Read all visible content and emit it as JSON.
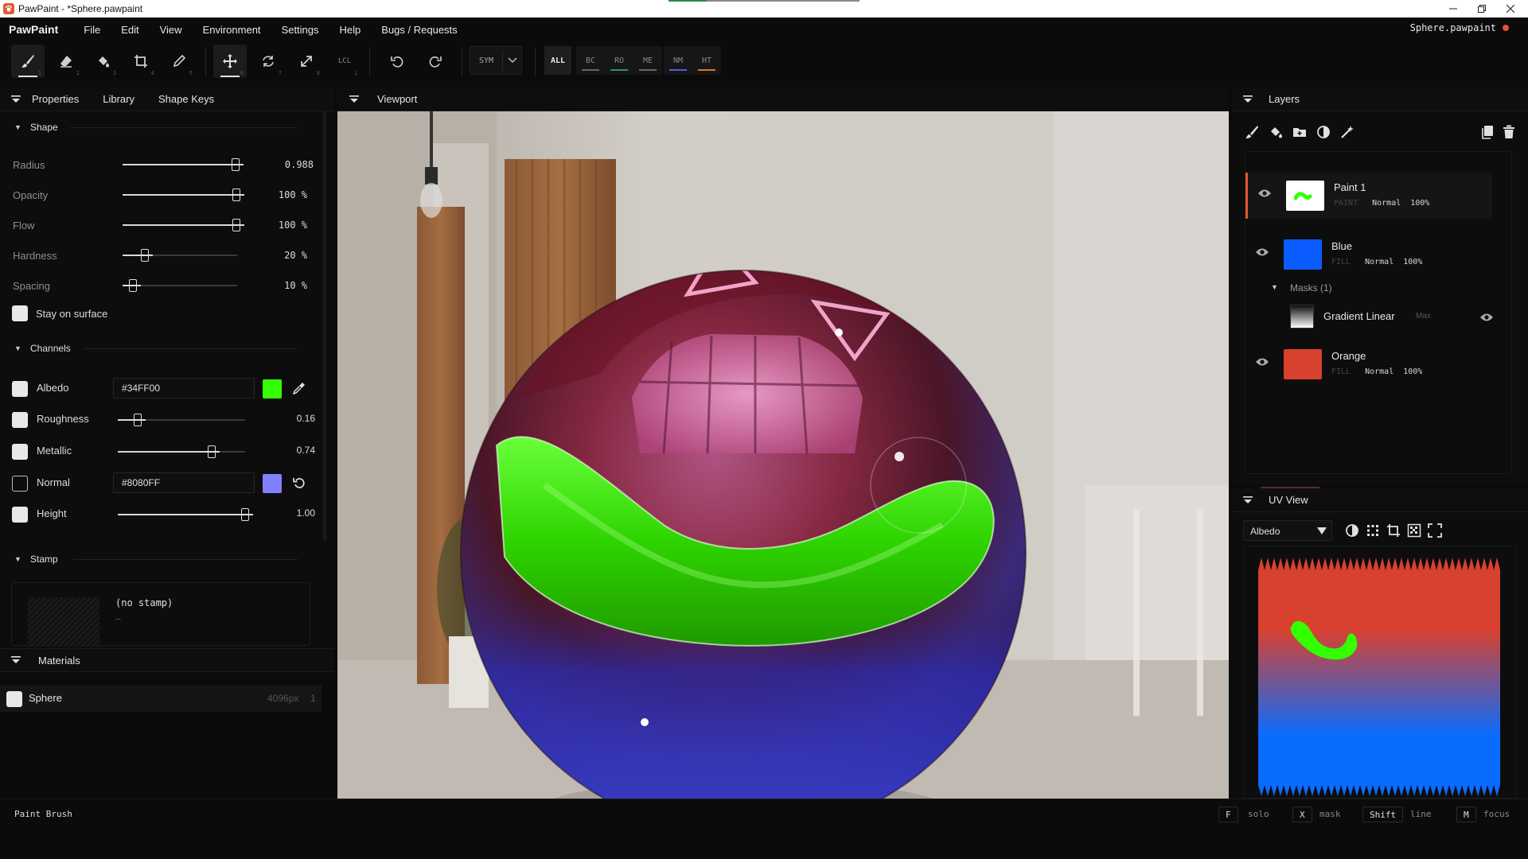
{
  "window": {
    "title": "PawPaint - *Sphere.pawpaint",
    "controls": [
      "minimize-icon",
      "restore-icon",
      "close-icon"
    ]
  },
  "menu": {
    "brand": "PawPaint",
    "items": [
      "File",
      "Edit",
      "View",
      "Environment",
      "Settings",
      "Help",
      "Bugs / Requests"
    ],
    "open_file": "Sphere.pawpaint",
    "unsaved_color": "#e8502e"
  },
  "toolbar": {
    "tools": [
      {
        "name": "brush-icon",
        "key": "1",
        "active": true
      },
      {
        "name": "eraser-icon",
        "key": "2"
      },
      {
        "name": "fill-bucket-icon",
        "key": "3"
      },
      {
        "name": "crop-icon",
        "key": "4"
      },
      {
        "name": "eyedropper-icon",
        "key": "5"
      },
      {
        "name": "move-icon",
        "key": "6",
        "active": true
      },
      {
        "name": "rotate-icon",
        "key": "7"
      },
      {
        "name": "scale-icon",
        "key": "8"
      },
      {
        "name": "local-icon",
        "key": "L"
      }
    ],
    "local_label": "LCL",
    "undo": "undo-icon",
    "redo": "redo-icon",
    "sym_label": "SYM",
    "channels": [
      {
        "label": "ALL",
        "color": ""
      },
      {
        "label": "BC",
        "color": "#666666"
      },
      {
        "label": "RO",
        "color": "#2a9a5a"
      },
      {
        "label": "ME",
        "color": "#666666"
      },
      {
        "label": "NM",
        "color": "#5a5adc"
      },
      {
        "label": "HT",
        "color": "#d07a2a"
      }
    ]
  },
  "left_panel": {
    "tabs": [
      "Properties",
      "Library",
      "Shape Keys"
    ],
    "shape": {
      "title": "Shape",
      "params": [
        {
          "label": "Radius",
          "value": "0.988",
          "level": 0.99
        },
        {
          "label": "Opacity",
          "value": "100 %",
          "level": 1.0
        },
        {
          "label": "Flow",
          "value": "100 %",
          "level": 1.0
        },
        {
          "label": "Hardness",
          "value": "20 %",
          "level": 0.2
        },
        {
          "label": "Spacing",
          "value": "10 %",
          "level": 0.1
        }
      ],
      "stay_on_surface": "Stay on surface"
    },
    "channels": {
      "title": "Channels",
      "albedo": {
        "label": "Albedo",
        "hex": "#34FF00",
        "color": "#34FF00"
      },
      "roughness": {
        "label": "Roughness",
        "value": "0.16",
        "level": 0.16
      },
      "metallic": {
        "label": "Metallic",
        "value": "0.74",
        "level": 0.74
      },
      "normal": {
        "label": "Normal",
        "hex": "#8080FF",
        "color": "#8080FF"
      },
      "height": {
        "label": "Height",
        "value": "1.00",
        "level": 1.0
      }
    },
    "stamp": {
      "title": "Stamp",
      "name": "(no stamp)",
      "sub": "–"
    }
  },
  "materials": {
    "title": "Materials",
    "items": [
      {
        "name": "Sphere",
        "size": "4096px",
        "count": "1"
      }
    ]
  },
  "viewport": {
    "title": "Viewport"
  },
  "layers": {
    "title": "Layers",
    "items": [
      {
        "name": "Paint 1",
        "type": "PAINT",
        "blend": "Normal",
        "opacity": "100%",
        "selected": true
      },
      {
        "name": "Blue",
        "type": "FILL",
        "blend": "Normal",
        "opacity": "100%",
        "color": "#0a5cff"
      },
      {
        "name": "Orange",
        "type": "FILL",
        "blend": "Normal",
        "opacity": "100%",
        "color": "#d8412e"
      }
    ],
    "masks_label": "Masks (1)",
    "mask": {
      "name": "Gradient Linear",
      "mode": "Max"
    }
  },
  "uv_view": {
    "title": "UV View",
    "channel": "Albedo"
  },
  "status": {
    "tool": "Paint Brush",
    "hints": [
      {
        "key": "F",
        "label": "solo"
      },
      {
        "key": "X",
        "label": "mask"
      },
      {
        "key": "Shift",
        "label": "line"
      },
      {
        "key": "M",
        "label": "focus"
      }
    ]
  }
}
